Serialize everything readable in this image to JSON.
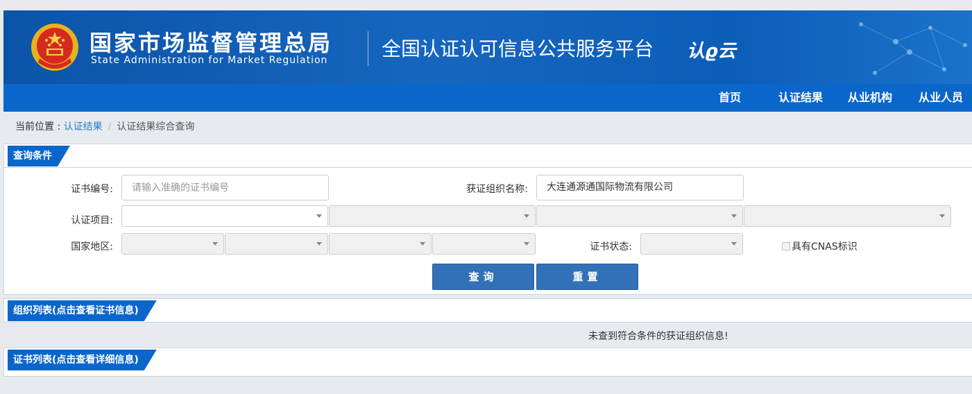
{
  "header": {
    "agency_cn": "国家市场监督管理总局",
    "agency_en": "State Administration  for  Market Regulation",
    "platform_title": "全国认证认可信息公共服务平台",
    "logo_text": "认ϱ云",
    "brand_color": "#0b54a8"
  },
  "nav": {
    "items": [
      {
        "label": "首页"
      },
      {
        "label": "认证结果"
      },
      {
        "label": "从业机构"
      },
      {
        "label": "从业人员"
      }
    ]
  },
  "breadcrumb": {
    "lead": "当前位置 : ",
    "link": "认证结果",
    "separator": "/",
    "current": "认证结果综合查询"
  },
  "query": {
    "section_title": "查询条件",
    "cert_no": {
      "label": "证书编号:",
      "value": "",
      "placeholder": "请输入准确的证书编号"
    },
    "org_name": {
      "label": "获证组织名称:",
      "value": "大连通源通国际物流有限公司"
    },
    "cert_project": {
      "label": "认证项目:"
    },
    "region": {
      "label": "国家地区:"
    },
    "cert_status": {
      "label": "证书状态:"
    },
    "cnas": {
      "label": "具有CNAS标识",
      "checked": false
    },
    "search_button": "查询",
    "reset_button": "重置"
  },
  "org_list": {
    "section_title": "组织列表(点击查看证书信息)",
    "empty_message": "未查到符合条件的获证组织信息!"
  },
  "cert_list": {
    "section_title": "证书列表(点击查看详细信息)"
  }
}
